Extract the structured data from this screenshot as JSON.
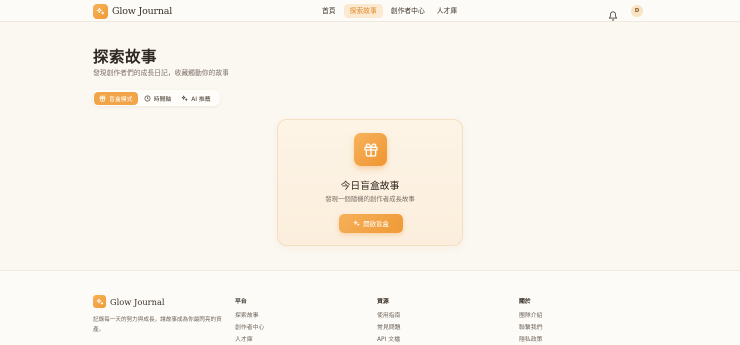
{
  "header": {
    "brand": "Glow Journal",
    "nav": [
      "首頁",
      "探索故事",
      "創作者中心",
      "人才庫"
    ],
    "active_nav": 1,
    "avatar_letter": "D"
  },
  "page": {
    "title": "探索故事",
    "subtitle": "發現創作者們的成長日記，收藏觸動你的故事"
  },
  "modes": [
    {
      "label": "盲盒模式",
      "icon": "gift-icon",
      "active": true
    },
    {
      "label": "時間軸",
      "icon": "clock-icon",
      "active": false
    },
    {
      "label": "AI 推薦",
      "icon": "sparkles-icon",
      "active": false
    }
  ],
  "card": {
    "title": "今日盲盒故事",
    "subtitle": "發現一個隨機的創作者成長故事",
    "button": "開啟盲盒"
  },
  "footer": {
    "brand": "Glow Journal",
    "description": "記錄每一天的努力與成長，讓故事成為你最閃亮的資產。",
    "columns": [
      {
        "head": "平台",
        "links": [
          "探索故事",
          "創作者中心",
          "人才庫"
        ]
      },
      {
        "head": "資源",
        "links": [
          "使用指南",
          "常見問題",
          "API 文檔"
        ]
      },
      {
        "head": "關於",
        "links": [
          "團隊介紹",
          "聯繫我們",
          "隱私政策"
        ]
      }
    ]
  },
  "colors": {
    "accent": "#f2a449",
    "background": "#fbf8f2",
    "card": "#fdf4e6"
  }
}
